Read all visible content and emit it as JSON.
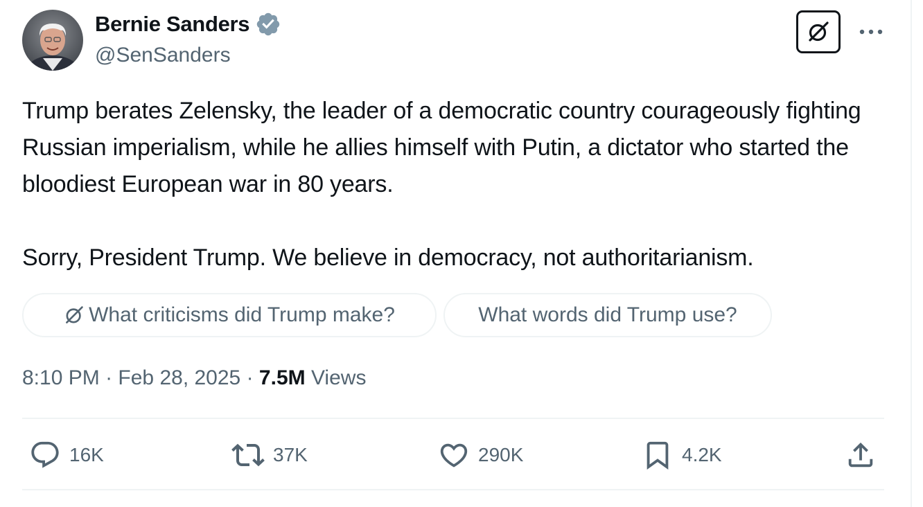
{
  "author": {
    "display_name": "Bernie Sanders",
    "handle": "@SenSanders",
    "verified_color": "#829aab"
  },
  "tweet": {
    "paragraph_1": "Trump berates Zelensky, the leader of a democratic country courageously fighting Russian imperialism, while he allies himself with Putin, a dictator who started the bloodiest European war in 80 years.",
    "paragraph_2": "Sorry, President Trump. We believe in democracy, not authoritarianism."
  },
  "suggestions": [
    {
      "label": "What criticisms did Trump make?",
      "icon": "grok-icon"
    },
    {
      "label": "What words did Trump use?"
    }
  ],
  "meta": {
    "time": "8:10 PM",
    "date": "Feb 28, 2025",
    "separator": "·",
    "views_count": "7.5M",
    "views_label": "Views"
  },
  "actions": {
    "replies": "16K",
    "reposts": "37K",
    "likes": "290K",
    "bookmarks": "4.2K"
  },
  "icons": [
    "verified-badge-icon",
    "grok-icon",
    "more-icon",
    "reply-icon",
    "repost-icon",
    "like-icon",
    "bookmark-icon",
    "share-icon"
  ],
  "colors": {
    "text_primary": "#0f1419",
    "text_secondary": "#536471",
    "border": "#eff3f4"
  }
}
